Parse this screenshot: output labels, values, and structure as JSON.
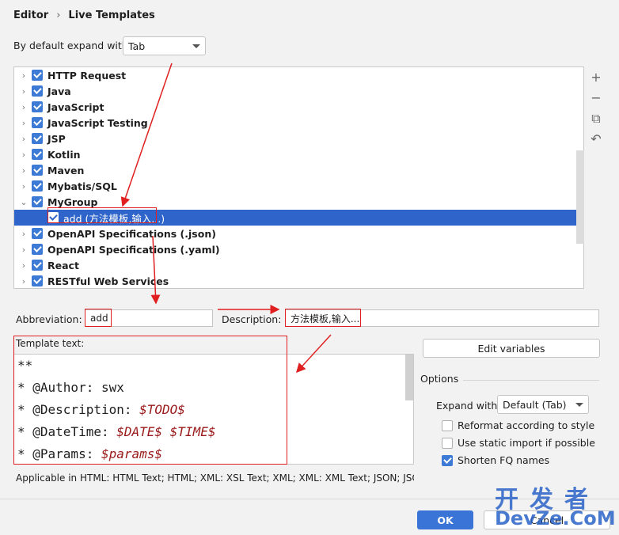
{
  "breadcrumb": {
    "root": "Editor",
    "separator": "›",
    "page": "Live Templates"
  },
  "expand": {
    "label": "By default expand with",
    "value": "Tab"
  },
  "tree": {
    "items": [
      {
        "label": "HTTP Request",
        "expanded": false,
        "checked": true
      },
      {
        "label": "Java",
        "expanded": false,
        "checked": true
      },
      {
        "label": "JavaScript",
        "expanded": false,
        "checked": true
      },
      {
        "label": "JavaScript Testing",
        "expanded": false,
        "checked": true
      },
      {
        "label": "JSP",
        "expanded": false,
        "checked": true
      },
      {
        "label": "Kotlin",
        "expanded": false,
        "checked": true
      },
      {
        "label": "Maven",
        "expanded": false,
        "checked": true
      },
      {
        "label": "Mybatis/SQL",
        "expanded": false,
        "checked": true
      },
      {
        "label": "MyGroup",
        "expanded": true,
        "checked": true
      },
      {
        "label": "add (方法模板,输入...)",
        "child": true,
        "selected": true,
        "checked": true
      },
      {
        "label": "OpenAPI Specifications (.json)",
        "expanded": false,
        "checked": true
      },
      {
        "label": "OpenAPI Specifications (.yaml)",
        "expanded": false,
        "checked": true
      },
      {
        "label": "React",
        "expanded": false,
        "checked": true
      },
      {
        "label": "RESTful Web Services",
        "expanded": false,
        "checked": true
      }
    ],
    "tools": [
      "+",
      "−",
      "⧉",
      "↶"
    ],
    "tool_names": [
      "add",
      "remove",
      "copy",
      "revert"
    ]
  },
  "abbreviation": {
    "label": "Abbreviation:",
    "value": "add"
  },
  "description": {
    "label": "Description:",
    "value": "方法模板,输入..."
  },
  "template": {
    "label": "Template text:",
    "lines": [
      {
        "text": "**",
        "var": ""
      },
      {
        "text": "* @Author: swx",
        "var": ""
      },
      {
        "text": "* @Description: ",
        "var": "$TODO$"
      },
      {
        "text": "* @DateTime: ",
        "var": "$DATE$ $TIME$"
      },
      {
        "text": "* @Params: ",
        "var": "$params$"
      }
    ]
  },
  "applicable": "Applicable in HTML: HTML Text; HTML; XML: XSL Text; XML; XML: XML Text; JSON; JSON",
  "edit_variables": "Edit variables",
  "options": {
    "title": "Options",
    "expand_label": "Expand with",
    "expand_value": "Default (Tab)",
    "reformat": {
      "label": "Reformat according to style",
      "checked": false
    },
    "static_import": {
      "label": "Use static import if possible",
      "checked": false
    },
    "shorten_fq": {
      "label": "Shorten FQ names",
      "checked": true
    }
  },
  "buttons": {
    "ok": "OK",
    "cancel": "Cancel"
  },
  "watermark": {
    "line1": "开发者",
    "line2": "DevZe.CoM"
  },
  "colors": {
    "selection": "#2f65ca",
    "checkbox": "#3d7ad6",
    "annotation": "#e02020",
    "ok_button": "#3a74d6"
  }
}
